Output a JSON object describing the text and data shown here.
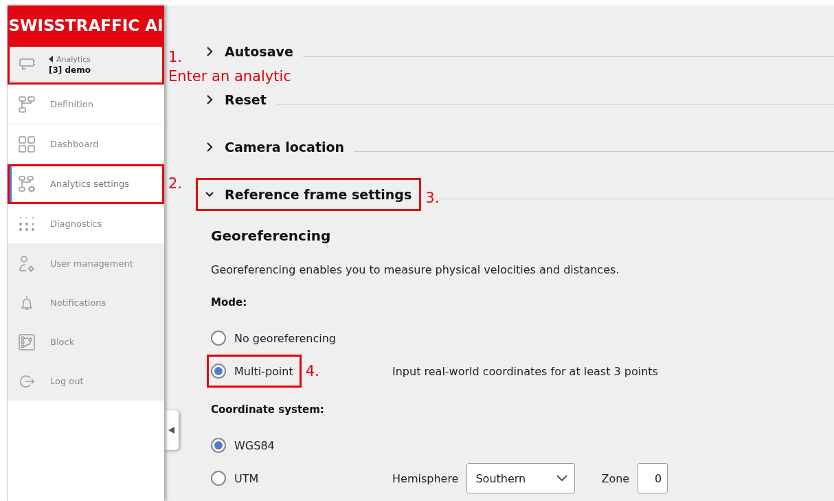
{
  "logo": "SWISSTRAFFIC AI",
  "sidebar": {
    "header": {
      "back_label": "Analytics",
      "title": "[3] demo",
      "highlighted": true,
      "annotation": [
        "1.",
        "Enter an analytic"
      ]
    },
    "items": [
      {
        "label": "Definition",
        "kind": "analytic",
        "selected": false,
        "highlighted": false
      },
      {
        "label": "Dashboard",
        "kind": "analytic",
        "selected": false,
        "highlighted": false
      },
      {
        "label": "Analytics settings",
        "kind": "analytic",
        "selected": true,
        "highlighted": true,
        "annotation": [
          "2."
        ]
      },
      {
        "label": "Diagnostics",
        "kind": "analytic",
        "selected": false,
        "highlighted": false
      },
      {
        "label": "User management",
        "kind": "account",
        "selected": false,
        "highlighted": false
      },
      {
        "label": "Notifications",
        "kind": "account",
        "selected": false,
        "highlighted": false
      },
      {
        "label": "Block",
        "kind": "account",
        "selected": false,
        "highlighted": false
      },
      {
        "label": "Log out",
        "kind": "account",
        "selected": false,
        "highlighted": false
      }
    ]
  },
  "sections": [
    {
      "title": "Autosave",
      "expanded": false,
      "highlighted": false
    },
    {
      "title": "Reset",
      "expanded": false,
      "highlighted": false
    },
    {
      "title": "Camera location",
      "expanded": false,
      "highlighted": false
    },
    {
      "title": "Reference frame settings",
      "expanded": true,
      "highlighted": true,
      "annotation": [
        "3."
      ]
    }
  ],
  "georeferencing": {
    "heading": "Georeferencing",
    "description": "Georeferencing enables you to measure physical velocities and distances.",
    "mode_label": "Mode:",
    "modes": [
      {
        "label": "No georeferencing",
        "selected": false,
        "highlighted": false
      },
      {
        "label": "Multi-point",
        "selected": true,
        "highlighted": true,
        "annotation": [
          "4."
        ],
        "note": "Input real-world coordinates for at least 3 points"
      }
    ],
    "coordinate_label": "Coordinate system:",
    "coordinate_systems": [
      {
        "label": "WGS84",
        "selected": true
      },
      {
        "label": "UTM",
        "selected": false,
        "hemisphere_label": "Hemisphere",
        "hemisphere": "Southern",
        "zone_label": "Zone",
        "zone": "0"
      }
    ]
  }
}
